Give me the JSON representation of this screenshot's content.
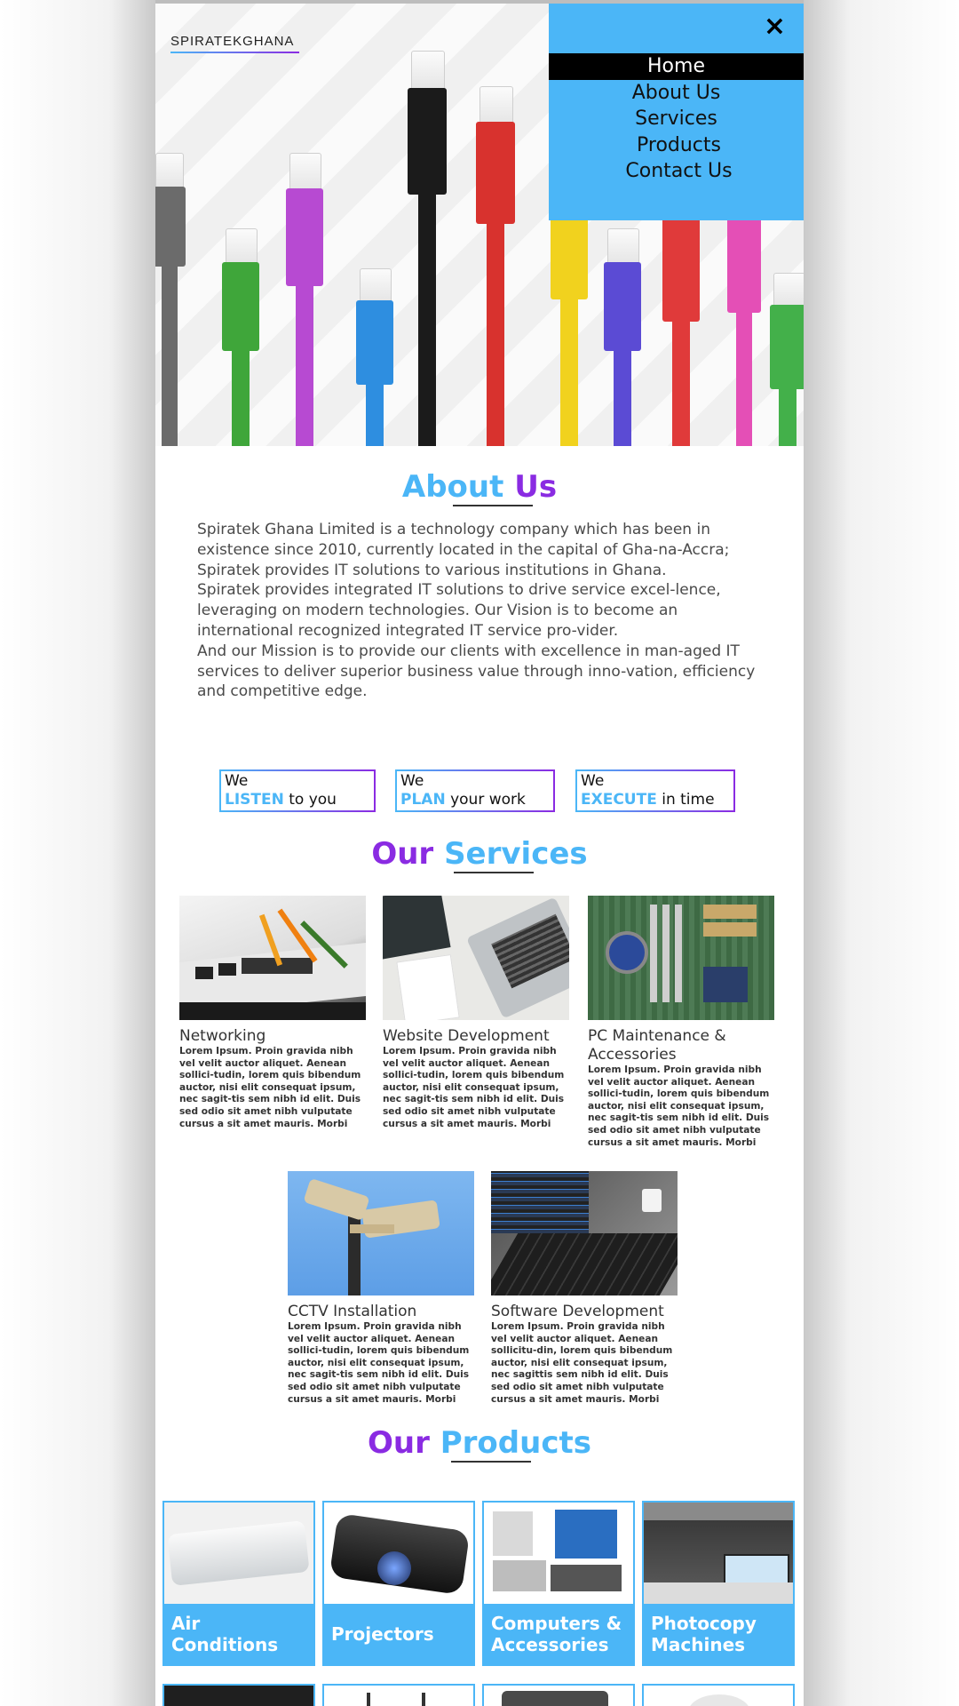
{
  "brand": {
    "logo": "SPIRATEKGHANA"
  },
  "nav": {
    "close_icon": "×",
    "items": [
      {
        "label": "Home",
        "active": true
      },
      {
        "label": "About Us",
        "active": false
      },
      {
        "label": "Services",
        "active": false
      },
      {
        "label": "Products",
        "active": false
      },
      {
        "label": "Contact Us",
        "active": false
      }
    ]
  },
  "about": {
    "title_part1": "About",
    "title_part2": "Us",
    "paragraphs": [
      "Spiratek Ghana Limited is a technology company which has been in existence since 2010, currently located in the capital of Gha-na-Accra; Spiratek provides IT solutions to various institutions in Ghana.",
      "Spiratek provides integrated IT solutions to drive service excel-lence, leveraging on modern technologies. Our Vision is to become an international recognized integrated IT service pro-vider.",
      "And our Mission is to provide our clients with excellence in man-aged IT services to deliver superior business value through inno-vation, efficiency and competitive edge."
    ],
    "tags": [
      {
        "prefix": "We",
        "accent": "LISTEN",
        "rest": " to you"
      },
      {
        "prefix": "We",
        "accent": "PLAN",
        "rest": " your work"
      },
      {
        "prefix": "We",
        "accent": "EXECUTE",
        "rest": " in time"
      }
    ]
  },
  "services": {
    "title_part1": "Our",
    "title_part2": "Services",
    "items": [
      {
        "title": "Networking",
        "body": "Lorem Ipsum. Proin gravida nibh vel velit auctor aliquet. Aenean sollici-tudin, lorem quis bibendum auctor, nisi elit consequat ipsum, nec sagit-tis sem nibh id elit. Duis sed odio sit amet nibh vulputate cursus a sit amet mauris. Morbi"
      },
      {
        "title": "Website Development",
        "body": "Lorem Ipsum. Proin gravida nibh vel velit auctor aliquet. Aenean sollici-tudin, lorem quis bibendum auctor, nisi elit consequat ipsum, nec sagit-tis sem nibh id elit. Duis sed odio sit amet nibh vulputate cursus a sit amet mauris. Morbi"
      },
      {
        "title": "PC Maintenance & Accessories",
        "body": "Lorem Ipsum. Proin gravida nibh vel velit auctor aliquet. Aenean sollici-tudin, lorem quis bibendum auctor, nisi elit consequat ipsum, nec sagit-tis sem nibh id elit. Duis sed odio sit amet nibh vulputate cursus a sit amet mauris. Morbi"
      },
      {
        "title": "CCTV Installation",
        "body": "Lorem Ipsum. Proin gravida nibh vel velit auctor aliquet. Aenean sollici-tudin, lorem quis bibendum auctor, nisi elit consequat ipsum, nec sagit-tis sem nibh id elit. Duis sed odio sit amet nibh vulputate cursus a sit amet mauris. Morbi"
      },
      {
        "title": "Software Development",
        "body": "Lorem Ipsum. Proin gravida nibh vel velit auctor aliquet. Aenean sollicitu-din, lorem quis bibendum auctor, nisi elit consequat ipsum, nec sagittis sem nibh id elit. Duis sed odio sit amet nibh vulputate cursus a sit amet mauris. Morbi"
      }
    ]
  },
  "products": {
    "title_part1": "Our",
    "title_part2": "Products",
    "items": [
      {
        "label": "Air Conditions"
      },
      {
        "label": "Projectors"
      },
      {
        "label": "Computers & Accessories"
      },
      {
        "label": "Photocopy Machines"
      }
    ]
  },
  "colors": {
    "accent_blue": "#4bb6f7",
    "accent_purple": "#8a2be2"
  }
}
